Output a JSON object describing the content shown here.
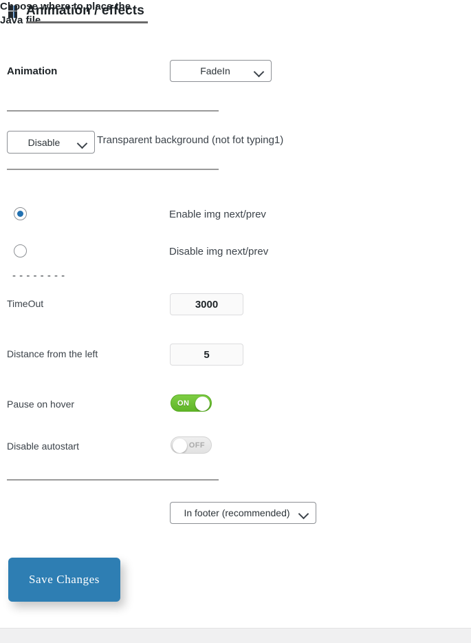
{
  "header": {
    "icon": "dashboard-grid-icon",
    "title": "Animation / effects"
  },
  "fields": {
    "animation": {
      "label": "Animation",
      "value": "FadeIn",
      "chevron": "chevron-down-icon"
    },
    "transparent": {
      "value": "Disable",
      "label": "Transparent background (not fot typing1)",
      "chevron": "chevron-down-icon"
    },
    "img_nav": {
      "enable_label": "Enable img next/prev",
      "disable_label": "Disable img next/prev",
      "selected": "enable"
    },
    "dashed_separator": "- - - - - - - - - - -",
    "timeout": {
      "label": "TimeOut",
      "value": "3000"
    },
    "distance": {
      "label": "Distance from the left",
      "value": "5"
    },
    "pause_on_hover": {
      "label": "Pause on hover",
      "state": "ON"
    },
    "disable_autostart": {
      "label": "Disable autostart",
      "state": "OFF"
    },
    "java_file": {
      "label": "Choose where to place the Java file",
      "value": "In footer (recommended)",
      "chevron": "chevron-down-icon"
    }
  },
  "actions": {
    "save_label": "Save Changes"
  },
  "colors": {
    "accent_blue": "#2271b1",
    "button_blue": "#2e7eb3",
    "toggle_on_green": "#6fc334",
    "toggle_off_gray": "#e8e8e8",
    "rule_gray": "#9a9a9a",
    "footer_gray": "#f0f0f1"
  }
}
